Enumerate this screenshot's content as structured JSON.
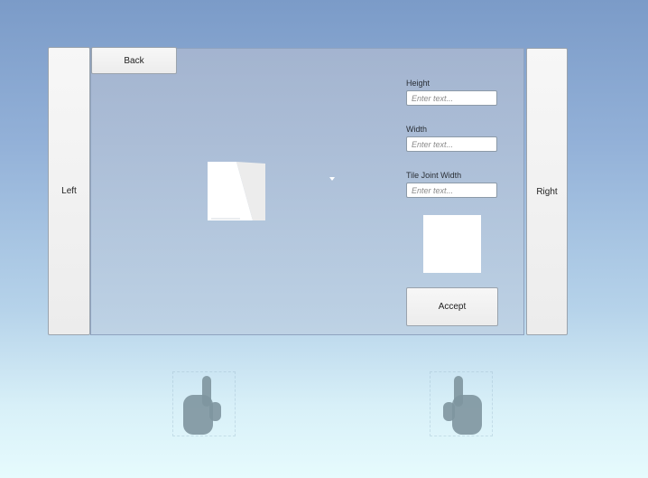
{
  "nav": {
    "left_label": "Left",
    "right_label": "Right",
    "back_label": "Back"
  },
  "form": {
    "height": {
      "label": "Height",
      "placeholder": "Enter text..."
    },
    "width": {
      "label": "Width",
      "placeholder": "Enter text..."
    },
    "joint": {
      "label": "Tile Joint Width",
      "placeholder": "Enter text..."
    },
    "accept_label": "Accept"
  },
  "icons": {
    "hand_left": "pointing-hand-icon",
    "hand_right": "pointing-hand-icon",
    "tile": "tile-preview-icon"
  },
  "colors": {
    "background_top": "#7b9bc8",
    "background_bottom": "#e6fbfd",
    "button_face": "#f2f2f2",
    "hand": "#7e959e"
  }
}
